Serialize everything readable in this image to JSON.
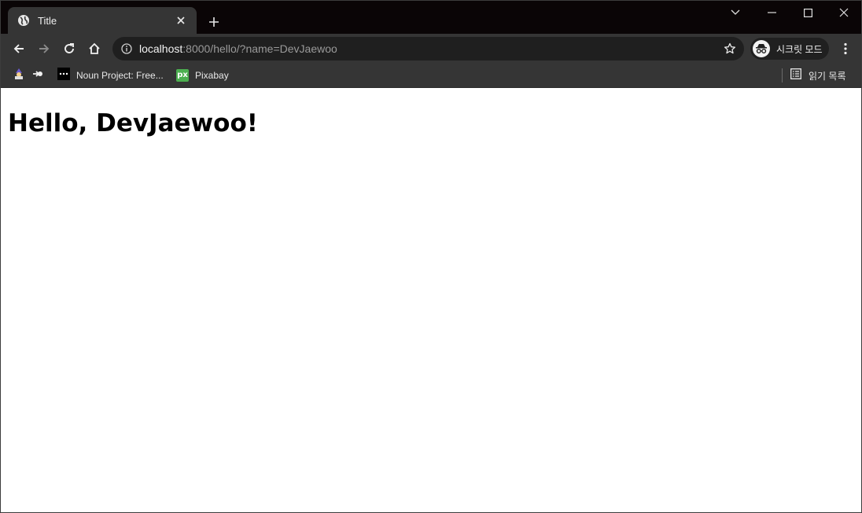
{
  "tab": {
    "title": "Title",
    "favicon": "globe-icon"
  },
  "toolbar": {
    "url_host": "localhost",
    "url_rest": ":8000/hello/?name=DevJaewoo",
    "incognito_label": "시크릿 모드"
  },
  "bookmarks": {
    "items": [
      {
        "label": "",
        "icon": "wizard-icon"
      },
      {
        "label": "",
        "icon": "arrow-in-icon"
      },
      {
        "label": "Noun Project: Free...",
        "icon": "noun-project-icon"
      },
      {
        "label": "Pixabay",
        "icon": "pixabay-icon",
        "icon_text": "px",
        "icon_color": "#4caf50"
      }
    ],
    "reading_list_label": "읽기 목록"
  },
  "page": {
    "heading": "Hello, DevJaewoo!"
  },
  "colors": {
    "titlebar": "#0a0506",
    "toolbar": "#353535",
    "omnibox": "#1f1f1f"
  }
}
